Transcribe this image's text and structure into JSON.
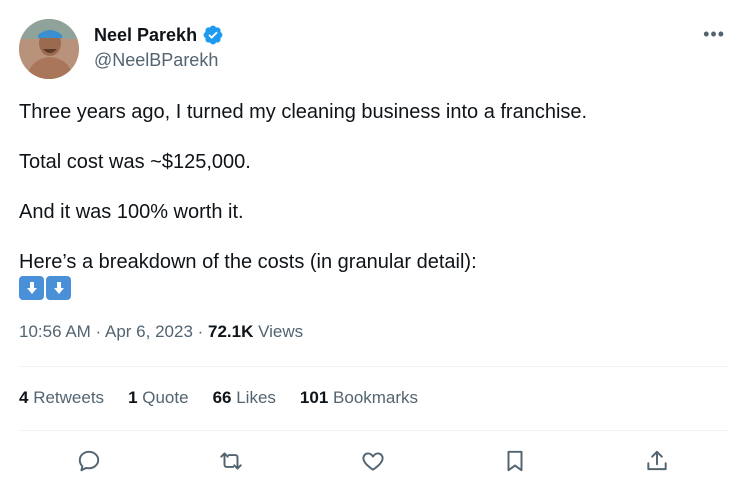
{
  "author": {
    "name": "Neel Parekh",
    "handle": "@NeelBParekh"
  },
  "more_label": "•••",
  "body": {
    "line1": "Three years ago, I turned my cleaning business into a franchise.",
    "line2": "Total cost was ~$125,000.",
    "line3": "And it was 100% worth it.",
    "line4": "Here’s a breakdown of the costs (in granular detail):"
  },
  "meta": {
    "time": "10:56 AM",
    "separator": " · ",
    "date": "Apr 6, 2023",
    "views_count": "72.1K",
    "views_label": " Views"
  },
  "stats": {
    "retweets_count": "4",
    "retweets_label": " Retweets",
    "quotes_count": "1",
    "quotes_label": " Quote",
    "likes_count": "66",
    "likes_label": " Likes",
    "bookmarks_count": "101",
    "bookmarks_label": " Bookmarks"
  },
  "colors": {
    "verified": "#1d9bf0",
    "secondary_text": "#536471",
    "icon": "#536471"
  },
  "icons": [
    "verified-badge-icon",
    "more-icon",
    "arrow-down-emoji-icon",
    "reply-icon",
    "retweet-icon",
    "like-icon",
    "bookmark-icon",
    "share-icon"
  ]
}
